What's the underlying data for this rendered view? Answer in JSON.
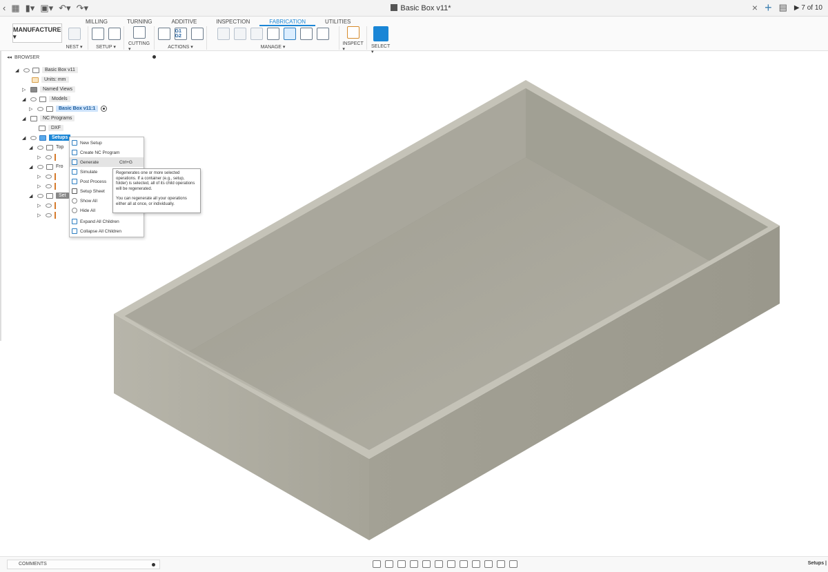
{
  "document": {
    "title": "Basic Box v11*",
    "version_count": "7 of 10"
  },
  "workspace": {
    "label": "MANUFACTURE ▾"
  },
  "tabs": [
    "MILLING",
    "TURNING",
    "ADDITIVE",
    "INSPECTION",
    "FABRICATION",
    "UTILITIES"
  ],
  "active_tab": "FABRICATION",
  "toolbar_groups": {
    "nest": "NEST ▾",
    "setup": "SETUP ▾",
    "cutting": "CUTTING ▾",
    "actions": "ACTIONS ▾",
    "manage": "MANAGE ▾",
    "inspect": "INSPECT ▾",
    "select": "SELECT ▾"
  },
  "icons": {
    "g1g2": "G1\nG2"
  },
  "browser": {
    "title": "BROWSER",
    "items": [
      {
        "label": "Basic Box v11"
      },
      {
        "label": "Units: mm"
      },
      {
        "label": "Named Views"
      },
      {
        "label": "Models"
      },
      {
        "label": "Basic Box v11:1"
      },
      {
        "label": "NC Programs"
      },
      {
        "label": "DXF"
      },
      {
        "label": "Setups"
      },
      {
        "label": "Top"
      },
      {
        "label": "Fro"
      },
      {
        "label": "Set"
      }
    ]
  },
  "context_menu": {
    "items": [
      {
        "label": "New Setup"
      },
      {
        "label": "Create NC Program"
      },
      {
        "label": "Generate",
        "shortcut": "Ctrl+G"
      },
      {
        "label": "Simulate"
      },
      {
        "label": "Post Process"
      },
      {
        "label": "Setup Sheet"
      },
      {
        "label": "Show All"
      },
      {
        "label": "Hide All"
      },
      {
        "label": "Expand All Children"
      },
      {
        "label": "Collapse All Children"
      }
    ]
  },
  "tooltip": {
    "p1": "Regenerates one or more selected operations. If a container (e.g., setup, folder) is selected, all of its child operations will be regenerated.",
    "p2": "You can regenerate all your operations either all at once, or individually."
  },
  "comments": {
    "label": "COMMENTS"
  },
  "status": {
    "text": "Setups |"
  },
  "colors": {
    "accent": "#1a86d6",
    "model": "#a8a69a"
  }
}
